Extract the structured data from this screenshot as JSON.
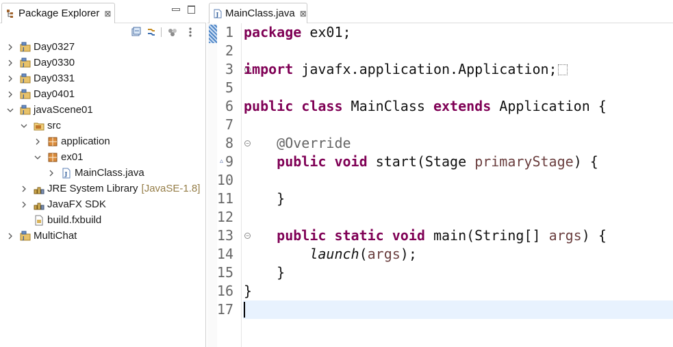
{
  "package_explorer": {
    "tab_title": "Package Explorer",
    "close_glyph": "⊠",
    "tree": [
      {
        "label": "Day0327",
        "icon": "project-icon",
        "depth": 0,
        "expanded": false
      },
      {
        "label": "Day0330",
        "icon": "project-icon",
        "depth": 0,
        "expanded": false
      },
      {
        "label": "Day0331",
        "icon": "project-icon",
        "depth": 0,
        "expanded": false
      },
      {
        "label": "Day0401",
        "icon": "project-icon",
        "depth": 0,
        "expanded": false
      },
      {
        "label": "javaScene01",
        "icon": "project-icon",
        "depth": 0,
        "expanded": true
      },
      {
        "label": "src",
        "icon": "source-folder-icon",
        "depth": 1,
        "expanded": true
      },
      {
        "label": "application",
        "icon": "package-icon",
        "depth": 2,
        "expanded": false
      },
      {
        "label": "ex01",
        "icon": "package-icon",
        "depth": 2,
        "expanded": true
      },
      {
        "label": "MainClass.java",
        "icon": "java-file-icon",
        "depth": 3,
        "expanded": false
      },
      {
        "label": "JRE System Library",
        "decoration": "[JavaSE-1.8]",
        "icon": "library-icon",
        "depth": 1,
        "expanded": false
      },
      {
        "label": "JavaFX SDK",
        "icon": "library-icon",
        "depth": 1,
        "expanded": false
      },
      {
        "label": "build.fxbuild",
        "icon": "file-icon",
        "depth": 1,
        "leaf": true
      },
      {
        "label": "MultiChat",
        "icon": "project-icon",
        "depth": 0,
        "expanded": false
      }
    ]
  },
  "editor": {
    "tab_title": "MainClass.java",
    "close_glyph": "⊠",
    "line_numbers": [
      "1",
      "2",
      "3",
      "5",
      "6",
      "7",
      "8",
      "9",
      "10",
      "11",
      "12",
      "13",
      "14",
      "15",
      "16",
      "17"
    ],
    "code": {
      "l1": [
        "package",
        " ex01;"
      ],
      "l3": [
        "import",
        " javafx.application.Application;"
      ],
      "l6": [
        "public",
        " ",
        "class",
        " MainClass ",
        "extends",
        " Application {"
      ],
      "l8": [
        "    ",
        "@Override"
      ],
      "l9": [
        "    ",
        "public",
        " ",
        "void",
        " start(Stage ",
        "primaryStage",
        ") {"
      ],
      "l11": [
        "    }"
      ],
      "l13": [
        "    ",
        "public",
        " ",
        "static",
        " ",
        "void",
        " main(String[] ",
        "args",
        ") {"
      ],
      "l14": [
        "        ",
        "launch",
        "(",
        "args",
        ");"
      ],
      "l15": [
        "    }"
      ],
      "l16": [
        "}"
      ]
    }
  },
  "colors": {
    "keyword": "#7f0055",
    "annotation": "#646464",
    "parameter": "#6a3e3e",
    "current_line": "#e8f2fe"
  }
}
